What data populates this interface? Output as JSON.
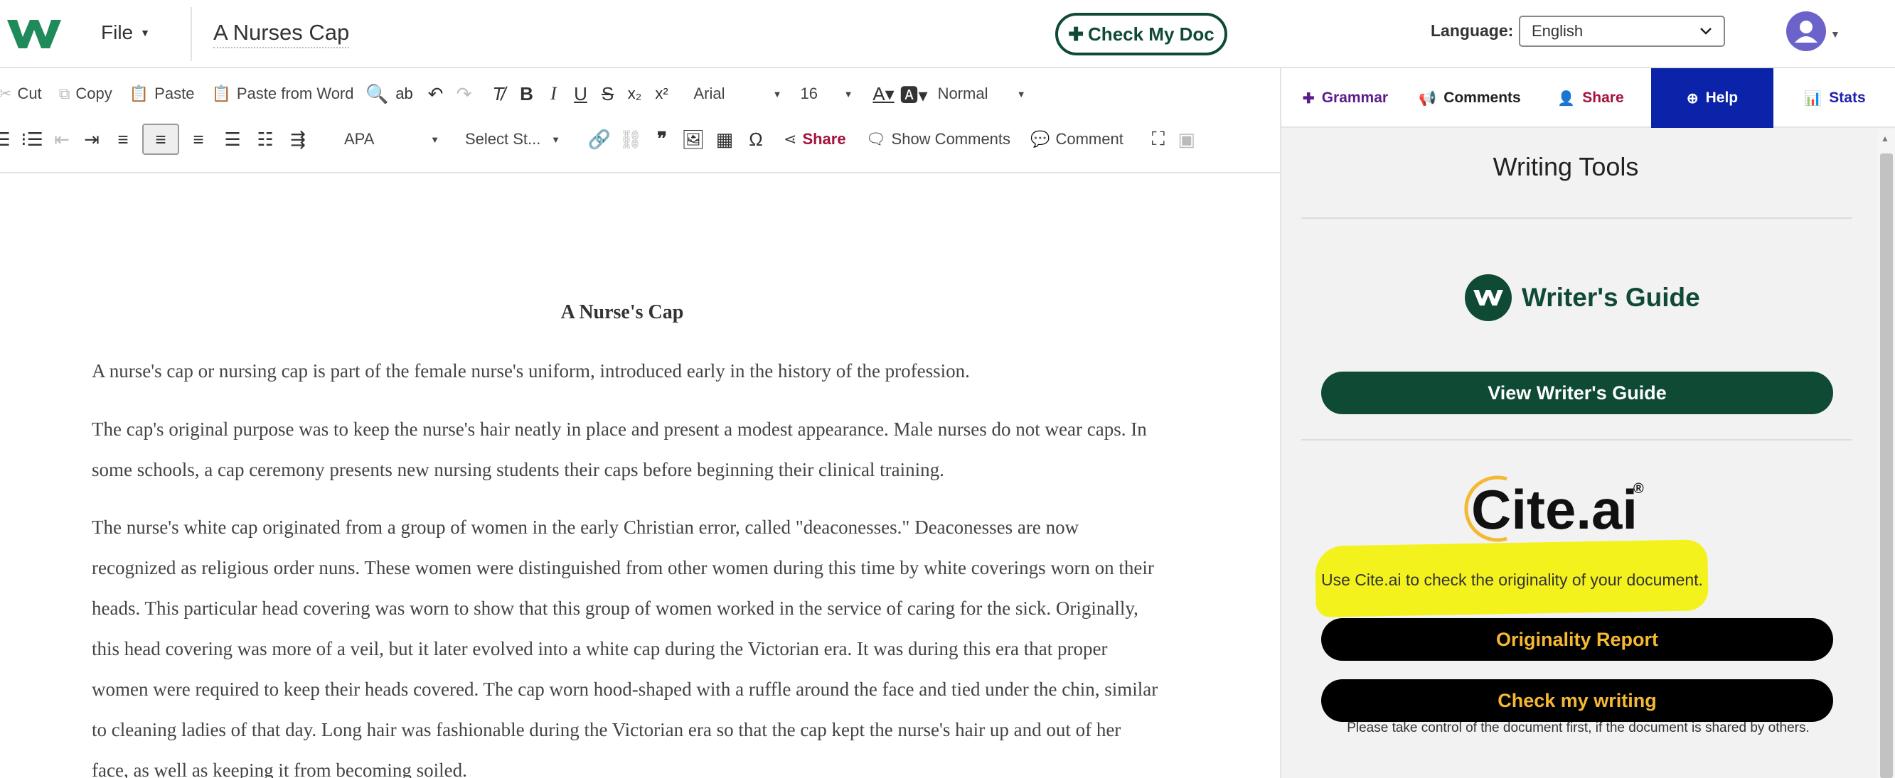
{
  "header": {
    "file_menu": "File",
    "doc_title": "A Nurses Cap",
    "check_doc": "Check My Doc",
    "language_label": "Language:",
    "language_value": "English"
  },
  "toolbar": {
    "row1": {
      "cut": "Cut",
      "copy": "Copy",
      "paste": "Paste",
      "paste_word": "Paste from Word",
      "font": "Arial",
      "size": "16",
      "style": "Normal"
    },
    "row2": {
      "citation_style": "APA",
      "select_style": "Select St...",
      "share": "Share",
      "show_comments": "Show Comments",
      "comment": "Comment"
    }
  },
  "document": {
    "heading": "A Nurse's Cap",
    "paragraphs": [
      "A nurse's cap or nursing cap is part of the female nurse's uniform, introduced early in the history of the profession.",
      "The cap's original purpose was to keep the nurse's hair neatly in place and present a modest appearance. Male nurses do not wear caps. In some schools, a cap ceremony presents new nursing students their caps before beginning their clinical training.",
      "The nurse's white cap originated from a group of women in the early Christian error,  called \"deaconesses.\" Deaconesses are now recognized as religious order nuns. These women were distinguished from other women during this time by white coverings worn on their heads. This particular head covering was worn to show that this group of women worked in the service of caring for the sick. Originally, this head covering was more of a veil, but it later evolved into a white cap during the Victorian era. It was during this era that proper women were required to keep their heads covered. The cap worn hood-shaped with a ruffle around the face and tied under the chin, similar to cleaning ladies of that day. Long hair was fashionable during the Victorian era so that the cap kept the nurse's hair up and out of her face, as well as keeping it from becoming soiled."
    ]
  },
  "panel": {
    "tabs": {
      "grammar": "Grammar",
      "comments": "Comments",
      "share": "Share",
      "help": "Help",
      "stats": "Stats"
    },
    "title": "Writing Tools",
    "writers_guide_logo": "Writer's Guide",
    "view_guide_button": "View Writer's Guide",
    "cite_logo": "Cite.ai",
    "cite_text": "Use Cite.ai to check the originality of your document.",
    "originality_button": "Originality Report",
    "check_writing_button": "Check my writing",
    "note": "Please take control of the document first, if the document is shared by others."
  },
  "colors": {
    "brand_green": "#0f4a35",
    "help_tab_blue": "#0a23a8",
    "share_red": "#a3133e",
    "cite_gold": "#f5b832",
    "highlight_yellow": "#f4f21c"
  }
}
